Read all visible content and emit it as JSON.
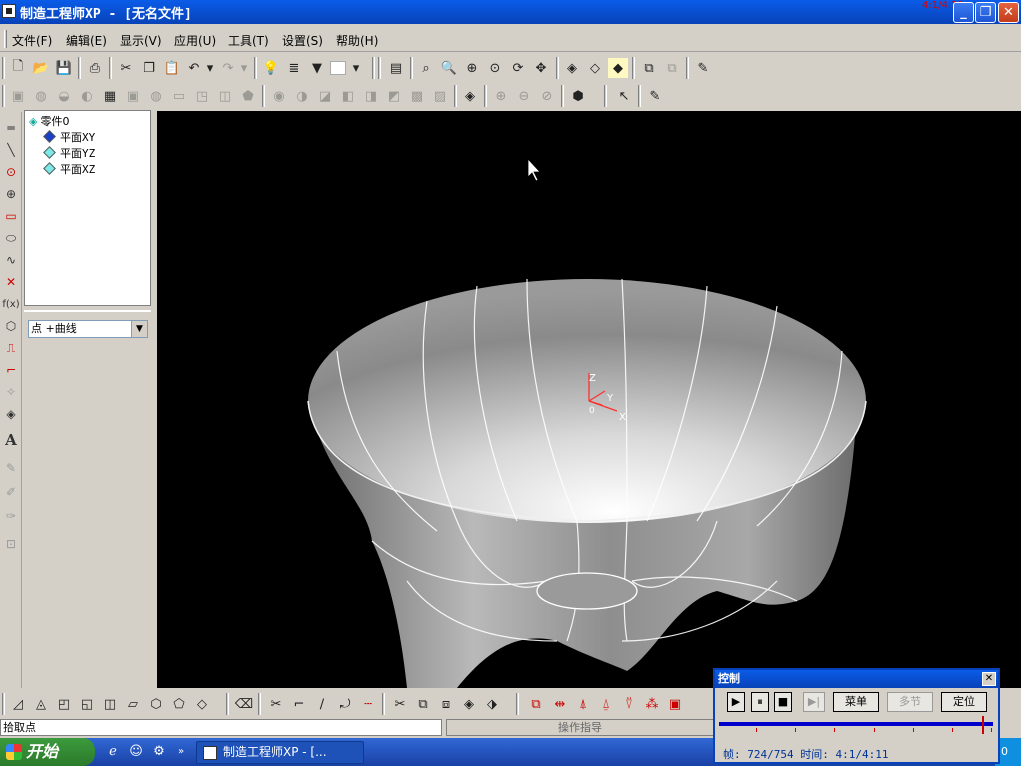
{
  "window": {
    "title": "制造工程师XP - [无名文件]",
    "ratio": "4:1/4:11",
    "min_label": "_",
    "max_label": "❐",
    "close_label": "✕"
  },
  "menu": [
    "文件(F)",
    "编辑(E)",
    "显示(V)",
    "应用(U)",
    "工具(T)",
    "设置(S)",
    "帮助(H)"
  ],
  "tree": {
    "root": "零件0",
    "items": [
      "平面XY",
      "平面YZ",
      "平面XZ"
    ]
  },
  "combo": {
    "value": "点 +曲线"
  },
  "lefttools": {
    "fx": "f(x)",
    "text": "A"
  },
  "axes": {
    "z": "Z",
    "y": "Y",
    "x": "X",
    "origin": "0"
  },
  "status": {
    "left": "拾取点",
    "middle": "操作指导"
  },
  "taskbar": {
    "start": "开始",
    "app": "制造工程师XP - [...",
    "tray": "0"
  },
  "control": {
    "title": "控制",
    "close_label": "✕",
    "play": "▶",
    "pause": "⏸",
    "stop": "■",
    "step": "▶|",
    "menu_btn": "菜单",
    "multi_btn": "多节",
    "locate_btn": "定位",
    "frame_label": "帧: 724/754",
    "time_label": "时间: 4:1/4:11",
    "progress": 0.96
  }
}
